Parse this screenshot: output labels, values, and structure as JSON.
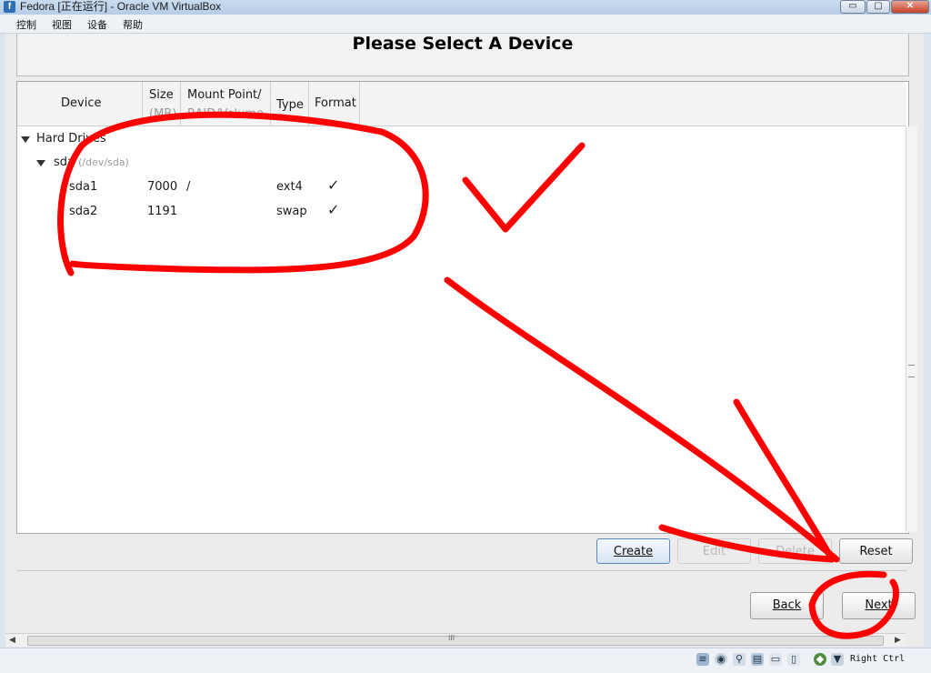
{
  "window": {
    "title": "Fedora [正在运行] - Oracle VM VirtualBox",
    "min_glyph": "▭",
    "max_glyph": "▢",
    "close_glyph": "✕"
  },
  "menu": [
    "控制",
    "视图",
    "设备",
    "帮助"
  ],
  "installer": {
    "title": "Please Select A Device",
    "columns": {
      "device": "Device",
      "size": "Size",
      "size_unit": "(MB)",
      "mount": "Mount Point/",
      "mount_sub": "RAID/Volume",
      "type": "Type",
      "format": "Format"
    },
    "tree": {
      "group": "Hard Drives",
      "disk": "sda",
      "disk_path": "(/dev/sda)",
      "partitions": [
        {
          "name": "sda1",
          "size": "7000",
          "mount": "/",
          "type": "ext4",
          "format": "✓"
        },
        {
          "name": "sda2",
          "size": "1191",
          "mount": "",
          "type": "swap",
          "format": "✓"
        }
      ]
    },
    "buttons": {
      "create": "Create",
      "edit": "Edit",
      "delete": "Delete",
      "reset": "Reset",
      "back": "Back",
      "next": "Next"
    }
  },
  "scrollbar": {
    "grip": "III"
  },
  "statusbar": {
    "host_key": "Right Ctrl"
  },
  "colors": {
    "annotation": "#ff0000",
    "titlebar": "#c4d8ee",
    "focus_border": "#5b87bd"
  }
}
